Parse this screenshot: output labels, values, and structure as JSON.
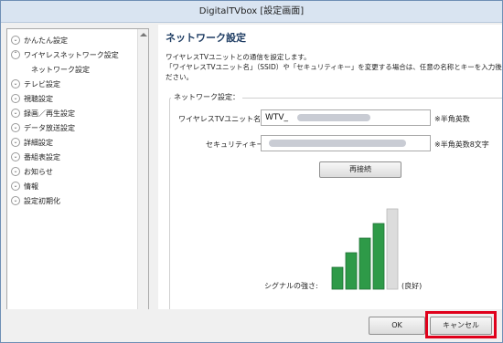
{
  "window": {
    "title": "DigitalTVbox [設定画面]"
  },
  "sidebar": {
    "items": [
      {
        "label": "かんたん設定",
        "icon": "chevron-down-icon"
      },
      {
        "label": "ワイヤレスネットワーク設定",
        "icon": "chevron-up-icon"
      },
      {
        "label": "ネットワーク設定",
        "sub": true
      },
      {
        "label": "テレビ設定",
        "icon": "chevron-down-icon"
      },
      {
        "label": "視聴設定",
        "icon": "chevron-down-icon"
      },
      {
        "label": "録画／再生設定",
        "icon": "chevron-down-icon"
      },
      {
        "label": "データ放送設定",
        "icon": "chevron-down-icon"
      },
      {
        "label": "詳細設定",
        "icon": "chevron-down-icon"
      },
      {
        "label": "番組表設定",
        "icon": "chevron-down-icon"
      },
      {
        "label": "お知らせ",
        "icon": "chevron-down-icon"
      },
      {
        "label": "情報",
        "icon": "chevron-down-icon"
      },
      {
        "label": "設定初期化",
        "icon": "chevron-down-icon"
      }
    ]
  },
  "main": {
    "title": "ネットワーク設定",
    "description": [
      "ワイヤレスTVユニットとの通信を設定します。",
      "「ワイヤレスTVユニット名」（SSID）や「セキュリティキー」を変更する場合は、任意の名称とキーを入力後、[再接続",
      "ださい。"
    ],
    "group_label": "ネットワーク設定：",
    "ssid": {
      "label": "ワイヤレスTVユニット名:",
      "value": "WTV_",
      "note": "※半角英数"
    },
    "security": {
      "label": "セキュリティキー:",
      "note": "※半角英数8文字"
    },
    "reconnect_label": "再接続",
    "signal": {
      "label": "シグナルの強さ:",
      "status": "(良好)",
      "level": 4,
      "max": 5,
      "color": "#2e9a48"
    }
  },
  "footer": {
    "ok_label": "OK",
    "cancel_label": "キャンセル",
    "highlight_color": "#e0001b"
  }
}
